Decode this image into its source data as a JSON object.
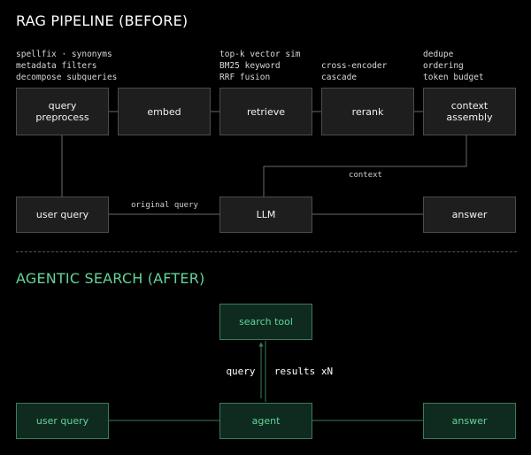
{
  "before": {
    "title": "RAG PIPELINE (BEFORE)",
    "notes": {
      "preprocess": [
        "spellfix · synonyms",
        "metadata filters",
        "decompose subqueries"
      ],
      "retrieve": [
        "top-k vector sim",
        "BM25 keyword",
        "RRF fusion"
      ],
      "rerank": [
        "cross-encoder",
        "cascade"
      ],
      "assembly": [
        "dedupe",
        "ordering",
        "token budget"
      ]
    },
    "nodes": {
      "query_preprocess": "query\npreprocess",
      "embed": "embed",
      "retrieve": "retrieve",
      "rerank": "rerank",
      "context_assembly": "context\nassembly",
      "user_query": "user query",
      "llm": "LLM",
      "answer": "answer"
    },
    "edges": {
      "context": "context",
      "original_query": "original query"
    }
  },
  "after": {
    "title": "AGENTIC SEARCH (AFTER)",
    "nodes": {
      "search_tool": "search tool",
      "user_query": "user query",
      "agent": "agent",
      "answer": "answer"
    },
    "edges": {
      "query": "query",
      "results": "results xN"
    }
  },
  "colors": {
    "background": "#000000",
    "old_box_fill": "#1e1e1e",
    "old_box_border": "#4c4c4c",
    "new_box_fill": "#0f2a1f",
    "new_box_border": "#3a7d5c",
    "accent_green": "#62d49a"
  }
}
